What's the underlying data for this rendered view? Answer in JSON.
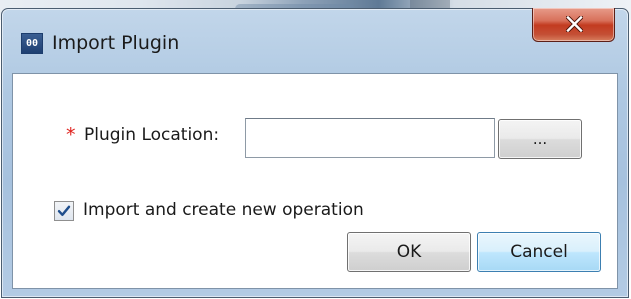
{
  "window": {
    "title": "Import Plugin",
    "app_icon_text": "00",
    "close_icon": "close-x-icon"
  },
  "form": {
    "required_marker": "*",
    "plugin_location_label": "Plugin Location:",
    "plugin_location_value": "",
    "plugin_location_placeholder": "",
    "browse_button_label": "...",
    "import_checkbox_checked": true,
    "import_checkbox_label": "Import and create new operation"
  },
  "actions": {
    "ok_label": "OK",
    "cancel_label": "Cancel"
  },
  "colors": {
    "required_marker": "#e0201c",
    "close_button": "#c33b20",
    "checkmark": "#1f4e8c",
    "focused_button_border": "#3c7fb1"
  }
}
